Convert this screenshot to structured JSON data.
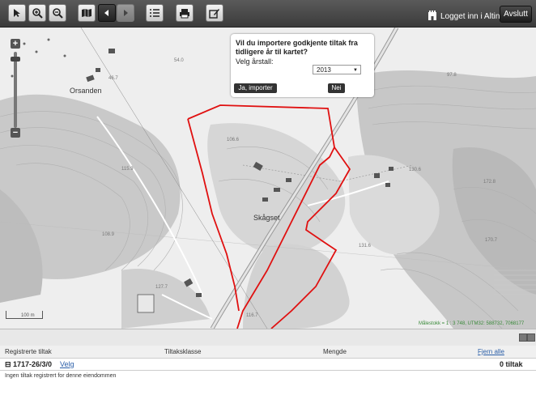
{
  "toolbar": {
    "login_label": "Logget inn i Altinn",
    "logout_label": "Avslutt"
  },
  "map": {
    "place_labels": [
      "Orsanden",
      "Skågset"
    ],
    "elevation_labels": [
      "54.0",
      "46.7",
      "106.6",
      "115.9",
      "108.9",
      "127.7",
      "116.7",
      "130.6",
      "172.8",
      "170.7",
      "131.6",
      "97.8"
    ],
    "scale_label": "100 m",
    "scale_info": "Målestokk = 1 : 3 748, UTM32: 588732, 7068177"
  },
  "dialog": {
    "question": "Vil du importere godkjente tiltak fra tidligere år til kartet?",
    "year_prompt": "Velg årstall:",
    "year_value": "2013",
    "yes_button": "Ja, importer",
    "no_button": "Nei"
  },
  "table": {
    "headers": {
      "registered": "Registrerte tiltak",
      "class": "Tiltaksklasse",
      "amount": "Mengde",
      "remove_all": "Fjern alle"
    },
    "property": {
      "id": "1717-26/3/0",
      "select_link": "Velg",
      "count": "0 tiltak"
    },
    "empty_message": "Ingen tiltak registrert for denne eiendommen"
  }
}
